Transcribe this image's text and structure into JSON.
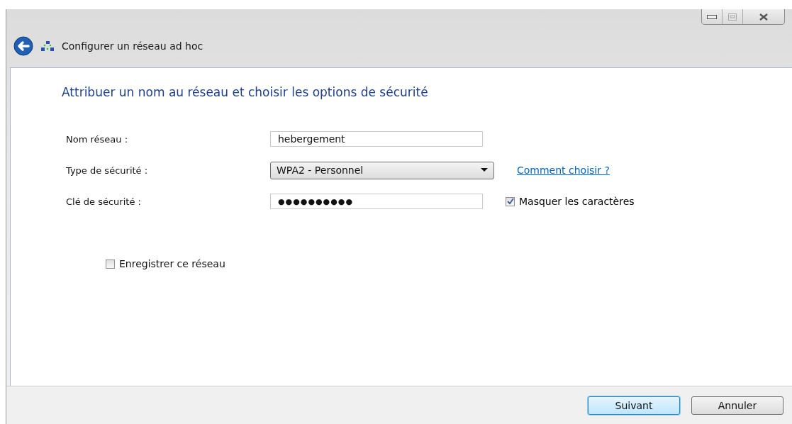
{
  "window": {
    "title": "Configurer un réseau ad hoc"
  },
  "heading": "Attribuer un nom au réseau et choisir les options de sécurité",
  "fields": [
    {
      "kind": "text",
      "label": "Nom réseau :",
      "value": "hebergement"
    },
    {
      "kind": "dropdown",
      "label": "Type de sécurité :",
      "value": "WPA2 - Personnel",
      "link": "Comment choisir ?"
    },
    {
      "kind": "text",
      "label": "Clé de sécurité :",
      "value": "●●●●●●●●●●",
      "checkbox": {
        "label": "Masquer les caractères",
        "checked": true
      }
    }
  ],
  "save_option": {
    "label": "Enregistrer ce réseau",
    "checked": false
  },
  "buttons": [
    {
      "label": "Suivant",
      "kind": "default"
    },
    {
      "label": "Annuler",
      "kind": "normal"
    }
  ]
}
